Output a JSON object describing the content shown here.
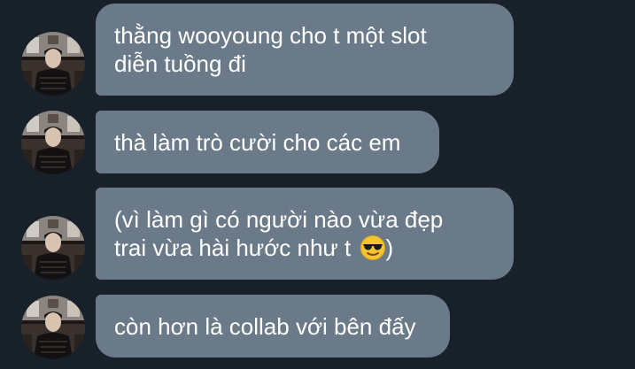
{
  "colors": {
    "background": "#18202a",
    "bubble": "#6b7a88",
    "text": "#ffffff"
  },
  "messages": [
    {
      "text": "thằng wooyoung cho t một slot\ndiễn tuồng đi"
    },
    {
      "text": "thà làm trò cười cho các em"
    },
    {
      "text": "(vì làm gì có người nào vừa đẹp\ntrai vừa hài hước như t ",
      "emoji": "smiling-face-with-sunglasses-icon",
      "text_after": ")"
    },
    {
      "text": "còn hơn là collab với bên đấy"
    }
  ]
}
